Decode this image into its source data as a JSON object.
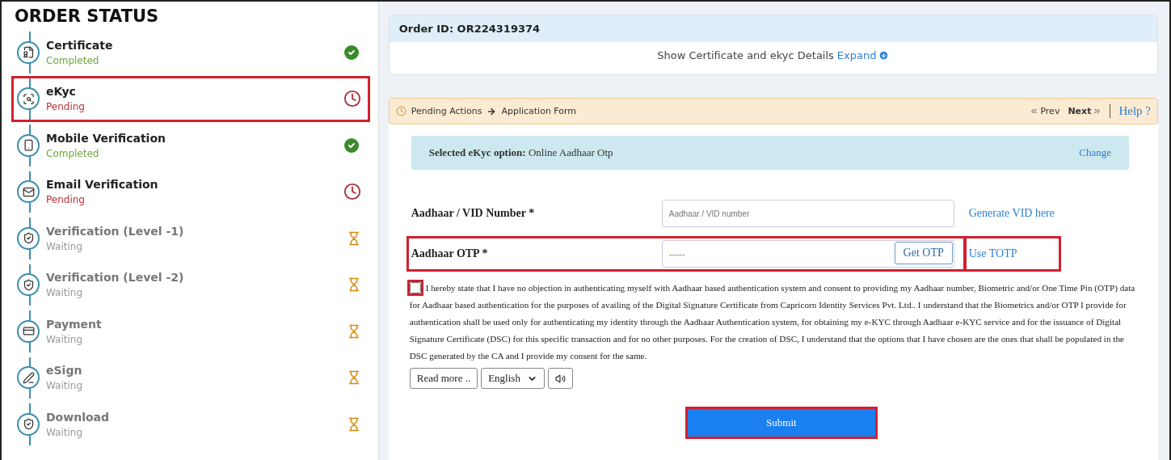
{
  "sidebar": {
    "title": "ORDER STATUS",
    "steps": [
      {
        "name": "Certificate",
        "status": "Completed",
        "kind": "completed",
        "selected": false
      },
      {
        "name": "eKyc",
        "status": "Pending",
        "kind": "pending",
        "selected": true
      },
      {
        "name": "Mobile Verification",
        "status": "Completed",
        "kind": "completed",
        "selected": false
      },
      {
        "name": "Email Verification",
        "status": "Pending",
        "kind": "pending",
        "selected": false
      },
      {
        "name": "Verification (Level -1)",
        "status": "Waiting",
        "kind": "waiting",
        "selected": false
      },
      {
        "name": "Verification (Level -2)",
        "status": "Waiting",
        "kind": "waiting",
        "selected": false
      },
      {
        "name": "Payment",
        "status": "Waiting",
        "kind": "waiting",
        "selected": false
      },
      {
        "name": "eSign",
        "status": "Waiting",
        "kind": "waiting",
        "selected": false
      },
      {
        "name": "Download",
        "status": "Waiting",
        "kind": "waiting",
        "selected": false
      }
    ]
  },
  "order": {
    "id_label": "Order ID: OR224319374",
    "details_text": "Show Certificate and ekyc Details",
    "expand_link": "Expand"
  },
  "actions_bar": {
    "breadcrumb_1": "Pending Actions",
    "breadcrumb_2": "Application Form",
    "prev": "Prev",
    "next": "Next",
    "help": "Help ?"
  },
  "ekyc_option": {
    "label": "Selected eKyc option:",
    "value": "Online Aadhaar Otp",
    "change": "Change"
  },
  "fields": [
    {
      "label": "Aadhaar / VID Number *",
      "placeholder": "Aadhaar / VID number",
      "link": "Generate VID here",
      "highlighted": false
    },
    {
      "label": "Aadhaar OTP *",
      "placeholder": "------",
      "button": "Get OTP",
      "link": "Use TOTP",
      "highlighted": true
    }
  ],
  "consent": {
    "checked": false,
    "highlighted": true,
    "text": "I hereby state that I have no objection in authenticating myself with Aadhaar based authentication system and consent to providing my Aadhaar number, Biometric and/or One Time Pin (OTP) data for Aadhaar based authentication for the purposes of availing of the Digital Signature Certificate from Capricorn Identity Services Pvt. Ltd.. I understand that the Biometrics and/or OTP I provide for authentication shall be used only for authenticating my identity through the Aadhaar Authentication system, for obtaining my e-KYC through Aadhaar e-KYC service and for the issuance of Digital Signature Certificate (DSC) for this specific transaction and for no other purposes. For the creation of DSC, I understand that the options that I have chosen are the ones that shall be populated in the DSC generated by the CA and I provide my consent for the same."
  },
  "consent_tools": {
    "read_more": "Read more ..",
    "language": "English"
  },
  "submit": {
    "label": "Submit",
    "highlighted": true
  }
}
